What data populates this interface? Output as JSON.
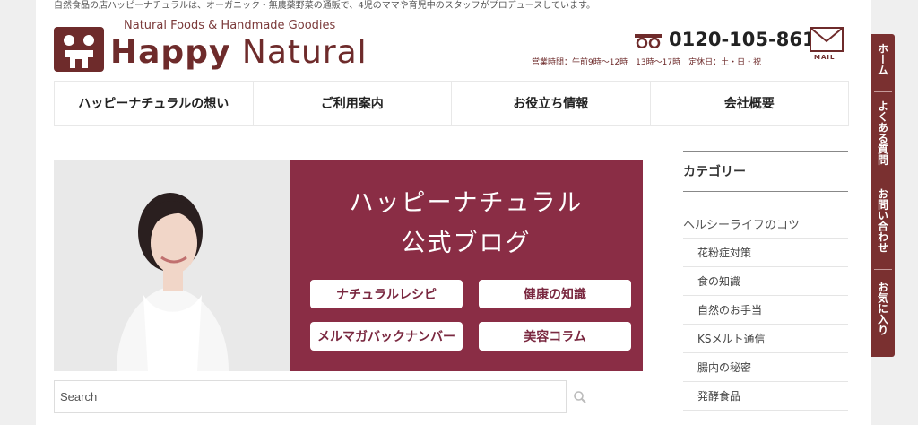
{
  "site": {
    "tagline": "自然食品の店ハッピーナチュラルは、オーガニック・無農薬野菜の通販で、4児のママや育児中のスタッフがプロデュースしています。",
    "logo_sub": "Natural Foods & Handmade Goodies",
    "logo_word1": "Happy",
    "logo_word2": "Natural",
    "brand_color": "#6e2b2b",
    "accent_color": "#8a2d45"
  },
  "contact": {
    "tel": "0120-105-861",
    "hours": "営業時間：午前9時～12時　13時～17時　定休日：土・日・祝",
    "mail_label": "MAIL"
  },
  "nav": [
    {
      "label": "ハッピーナチュラルの想い"
    },
    {
      "label": "ご利用案内"
    },
    {
      "label": "お役立ち情報"
    },
    {
      "label": "会社概要"
    }
  ],
  "banner": {
    "title_line1": "ハッピーナチュラル",
    "title_line2": "公式ブログ",
    "buttons": [
      {
        "label": "ナチュラルレシピ"
      },
      {
        "label": "健康の知識"
      },
      {
        "label": "メルマガバックナンバー"
      },
      {
        "label": "美容コラム"
      }
    ]
  },
  "search": {
    "placeholder": "Search"
  },
  "sidebar": {
    "heading": "カテゴリー",
    "parent": "ヘルシーライフのコツ",
    "items": [
      {
        "label": "花粉症対策"
      },
      {
        "label": "食の知識"
      },
      {
        "label": "自然のお手当"
      },
      {
        "label": "KSメルト通信"
      },
      {
        "label": "腸内の秘密"
      },
      {
        "label": "発酵食品"
      }
    ]
  },
  "side_tabs": [
    {
      "label": "ホーム"
    },
    {
      "label": "よくある質問"
    },
    {
      "label": "お問い合わせ"
    },
    {
      "label": "お気に入り"
    }
  ]
}
